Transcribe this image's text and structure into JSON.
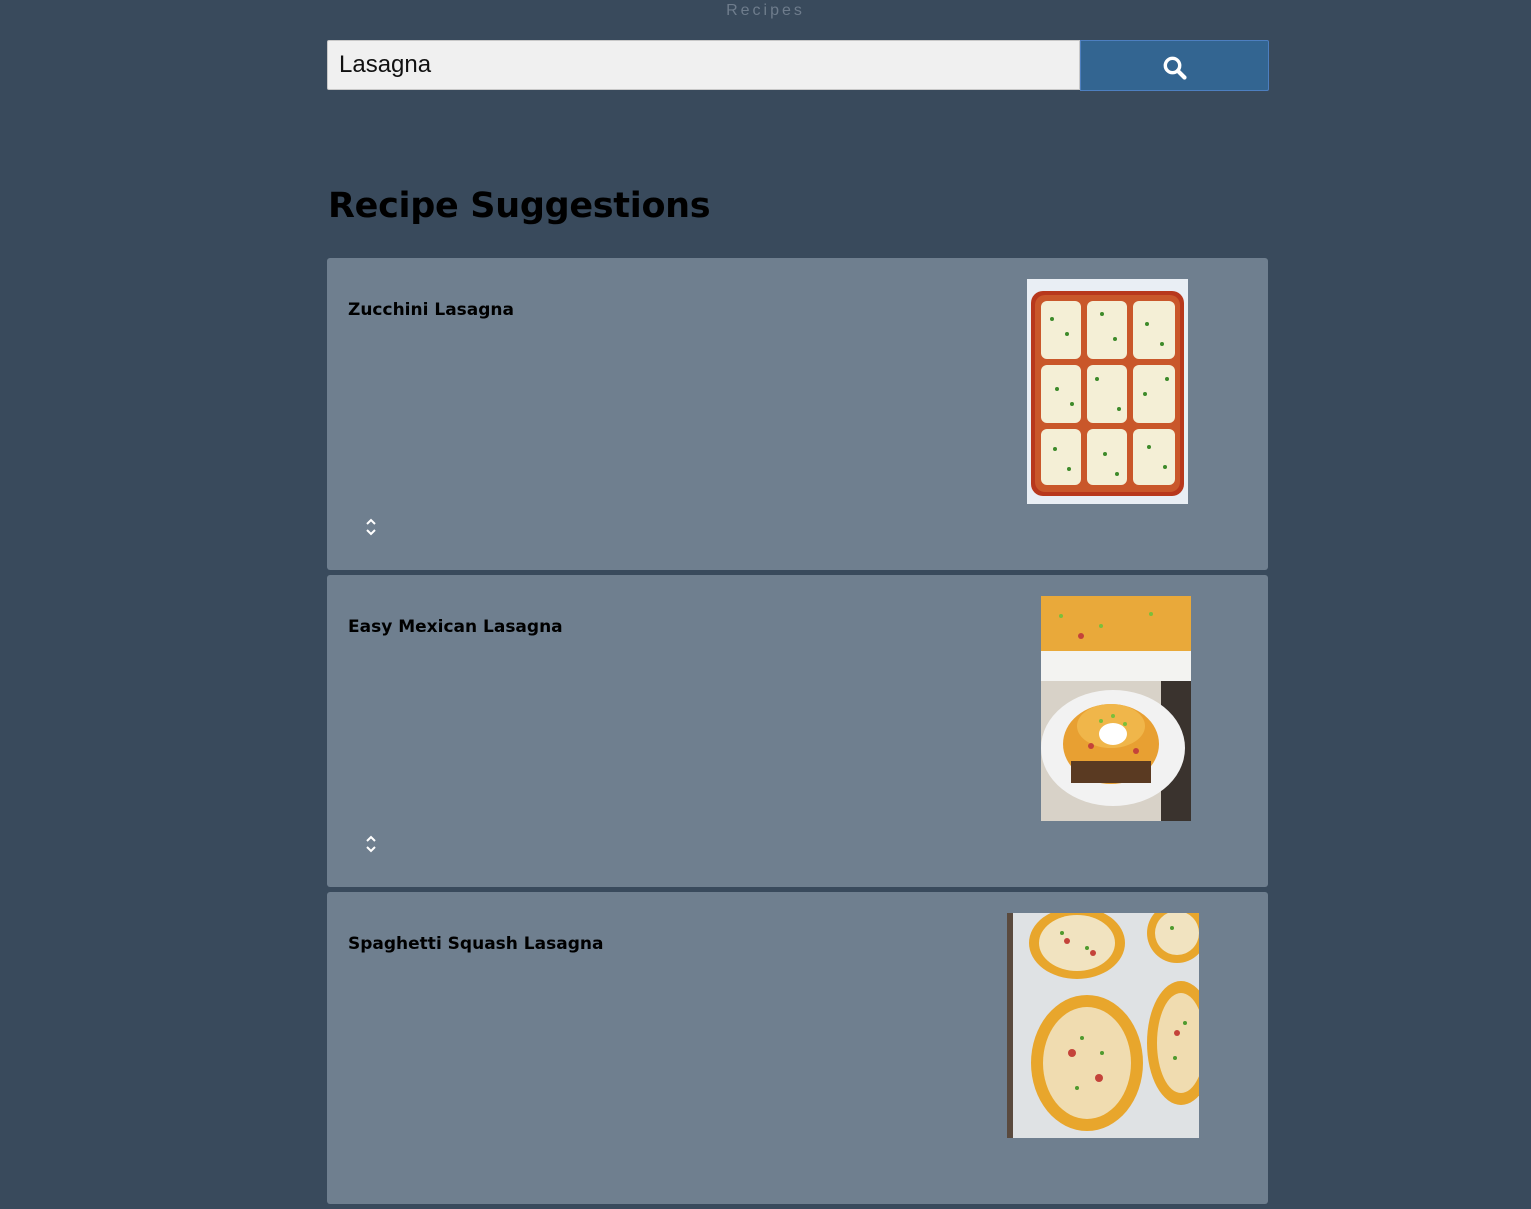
{
  "header": {
    "app_title": "Recipes"
  },
  "search": {
    "value": "Lasagna",
    "button_icon": "search-icon"
  },
  "main": {
    "heading": "Recipe Suggestions",
    "recipes": [
      {
        "title": "Zucchini Lasagna",
        "image": "zucchini-lasagna-photo",
        "toggle_icon": "expand-collapse-icon"
      },
      {
        "title": "Easy Mexican Lasagna",
        "image": "mexican-lasagna-photo",
        "toggle_icon": "expand-collapse-icon"
      },
      {
        "title": "Spaghetti Squash Lasagna",
        "image": "spaghetti-squash-lasagna-photo",
        "toggle_icon": "expand-collapse-icon"
      }
    ]
  },
  "colors": {
    "page_background": "#394a5c",
    "card_background": "#6f7f8f",
    "search_button": "#336591",
    "search_input": "#f0f0f0"
  }
}
